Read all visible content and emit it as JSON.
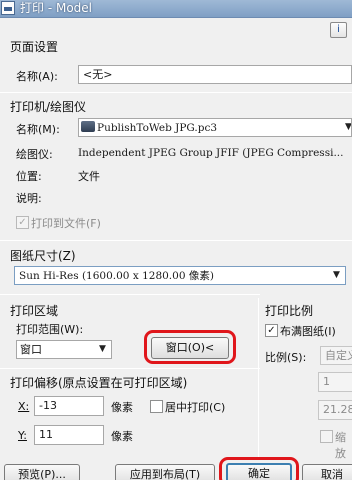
{
  "window": {
    "title": "打印 - Model",
    "help_label": "i"
  },
  "page_setup": {
    "section": "页面设置",
    "name_label": "名称(A):",
    "name_value": "<无>"
  },
  "printer": {
    "section": "打印机/绘图仪",
    "name_label": "名称(M):",
    "name_value": "PublishToWeb JPG.pc3",
    "plotter_label": "绘图仪:",
    "plotter_value": "Independent JPEG Group JFIF (JPEG Compressi...",
    "location_label": "位置:",
    "location_value": "文件",
    "description_label": "说明:",
    "print_to_file_label": "打印到文件(F)",
    "print_to_file_checked": true
  },
  "paper_size": {
    "section": "图纸尺寸(Z)",
    "value": "Sun Hi-Res (1600.00 x 1280.00 像素)"
  },
  "plot_area": {
    "section": "打印区域",
    "range_label": "打印范围(W):",
    "range_value": "窗口",
    "window_button": "窗口(O)<"
  },
  "plot_scale": {
    "section": "打印比例",
    "fit_label": "布满图纸(I)",
    "fit_checked": true,
    "scale_label": "比例(S):",
    "scale_value": "自定义",
    "value1": "1",
    "value2": "21.28",
    "scale_lineweights_label": "缩放"
  },
  "plot_offset": {
    "section": "打印偏移(原点设置在可打印区域)",
    "x_label": "X:",
    "x_value": "-13",
    "x_unit": "像素",
    "y_label": "Y:",
    "y_value": "11",
    "y_unit": "像素",
    "center_label": "居中打印(C)",
    "center_checked": false
  },
  "buttons": {
    "preview": "预览(P)...",
    "apply_layout": "应用到布局(T)",
    "ok": "确定",
    "cancel": "取消"
  },
  "colors": {
    "highlight": "#e0161b",
    "dialog_bg": "#f0f0f0",
    "titlebar": "#8fadd0"
  }
}
